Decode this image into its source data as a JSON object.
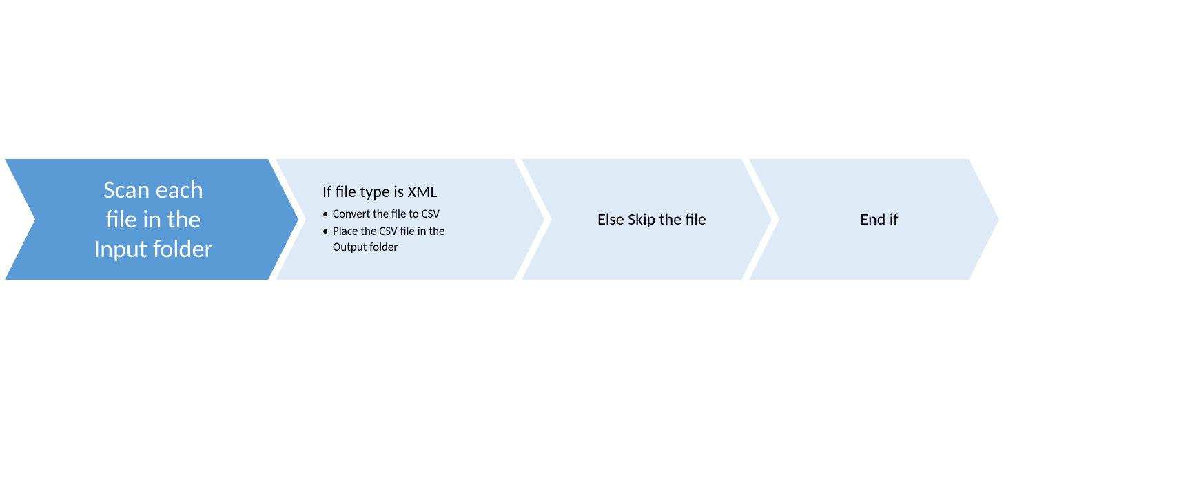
{
  "steps": {
    "step1": {
      "line1": "Scan each",
      "line2": "file in the",
      "line3": "Input folder"
    },
    "step2": {
      "title": "If file type is XML",
      "bullets": {
        "b1": "Convert the file to CSV",
        "b2": "Place the CSV file in the Output folder"
      }
    },
    "step3": {
      "text": "Else Skip the file"
    },
    "step4": {
      "text": "End if"
    }
  },
  "colors": {
    "primary": "#5b9bd5",
    "secondary": "#deebf7"
  }
}
